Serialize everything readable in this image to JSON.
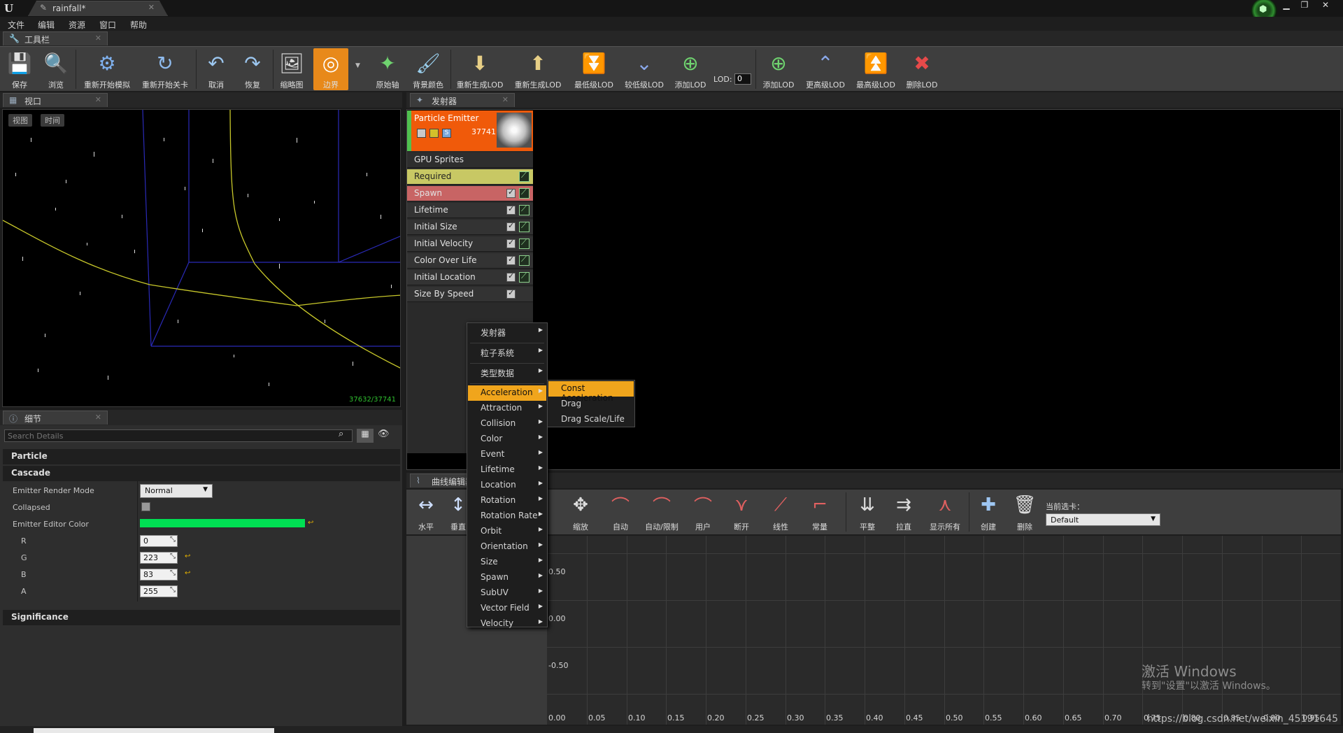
{
  "titlebar": {
    "doc_tab": "rainfall*",
    "close": "✕",
    "win_min": "▁",
    "win_max": "❐",
    "win_close": "✕"
  },
  "menubar": {
    "items": [
      "文件",
      "编辑",
      "资源",
      "窗口",
      "帮助"
    ]
  },
  "toolbar_tab": {
    "label": "工具栏",
    "close": "✕"
  },
  "toolbar": {
    "buttons": [
      "保存",
      "浏览",
      "重新开始模拟",
      "重新开始关卡",
      "取消",
      "恢复",
      "缩略图",
      "边界",
      "原始轴",
      "背景颜色",
      "重新生成LOD",
      "重新生成LOD",
      "最低级LOD",
      "较低级LOD",
      "添加LOD",
      "添加LOD",
      "更高级LOD",
      "最高级LOD",
      "删除LOD"
    ],
    "lod_label": "LOD:",
    "lod_value": "0"
  },
  "viewport": {
    "tab": "视口",
    "close": "✕",
    "btn_view": "视图",
    "btn_time": "时间",
    "particle_count": "37632/37741"
  },
  "details": {
    "tab": "细节",
    "close": "✕",
    "search_placeholder": "Search Details",
    "categories": [
      "Particle",
      "Cascade",
      "Significance"
    ],
    "emitter_render_mode_label": "Emitter Render Mode",
    "emitter_render_mode_value": "Normal",
    "collapsed_label": "Collapsed",
    "emitter_editor_color_label": "Emitter Editor Color",
    "color_hex": "#00df53",
    "r_label": "R",
    "r_value": "0",
    "g_label": "G",
    "g_value": "223",
    "b_label": "B",
    "b_value": "83",
    "a_label": "A",
    "a_value": "255"
  },
  "emitter": {
    "tab": "发射器",
    "close": "✕",
    "name": "Particle Emitter",
    "count": "37741",
    "type": "GPU Sprites",
    "modules": [
      "Required",
      "Spawn",
      "Lifetime",
      "Initial Size",
      "Initial Velocity",
      "Color Over Life",
      "Initial Location",
      "Size By Speed"
    ]
  },
  "context_menu": {
    "top_items": [
      "发射器",
      "粒子系统",
      "类型数据"
    ],
    "items": [
      "Acceleration",
      "Attraction",
      "Collision",
      "Color",
      "Event",
      "Lifetime",
      "Location",
      "Rotation",
      "Rotation Rate",
      "Orbit",
      "Orientation",
      "Size",
      "Spawn",
      "SubUV",
      "Vector Field",
      "Velocity"
    ],
    "highlighted": "Acceleration",
    "submenu": [
      "Const Acceleration",
      "Drag",
      "Drag Scale/Life"
    ],
    "submenu_highlighted": "Const Acceleration"
  },
  "curve_editor": {
    "tab": "曲线编辑器",
    "buttons": [
      "水平",
      "垂直",
      "缩放",
      "自动",
      "自动/限制",
      "用户",
      "断开",
      "线性",
      "常量",
      "平整",
      "拉直",
      "显示所有",
      "创建",
      "删除"
    ],
    "current_tab_label": "当前选卡：",
    "current_tab_value": "Default",
    "y_labels": [
      "0.50",
      "0.00",
      "-0.50"
    ],
    "x_labels": [
      "0.00",
      "0.05",
      "0.10",
      "0.15",
      "0.20",
      "0.25",
      "0.30",
      "0.35",
      "0.40",
      "0.45",
      "0.50",
      "0.55",
      "0.60",
      "0.65",
      "0.70",
      "0.75",
      "0.80",
      "0.85",
      "0.90",
      "0.95"
    ]
  },
  "watermark": {
    "line1": "激活 Windows",
    "line2": "转到\"设置\"以激活 Windows。",
    "csdn": "https://blog.csdn.net/weixin_45191645"
  }
}
